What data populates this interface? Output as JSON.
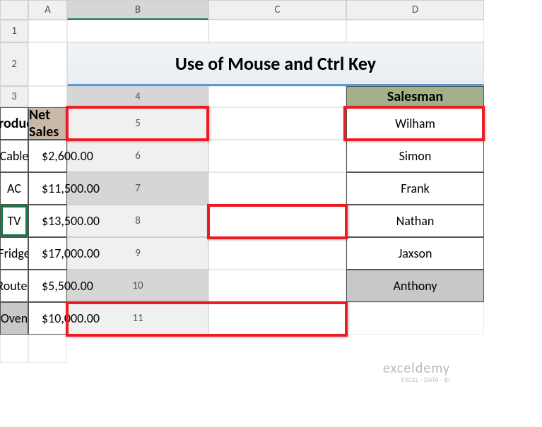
{
  "cols": [
    "A",
    "B",
    "C",
    "D"
  ],
  "rows": [
    "1",
    "2",
    "3",
    "4",
    "5",
    "6",
    "7",
    "8",
    "9",
    "10",
    "11"
  ],
  "title": "Use of Mouse and Ctrl Key",
  "headers": {
    "b": "Salesman",
    "c": "Product",
    "d": "Net Sales"
  },
  "table": [
    {
      "salesman": "Wilham",
      "product": "Cable",
      "sym": "$",
      "sales": "2,600.00"
    },
    {
      "salesman": "Simon",
      "product": "AC",
      "sym": "$",
      "sales": "11,500.00"
    },
    {
      "salesman": "Frank",
      "product": "TV",
      "sym": "$",
      "sales": "13,500.00"
    },
    {
      "salesman": "Nathan",
      "product": "Fridge",
      "sym": "$",
      "sales": "17,000.00"
    },
    {
      "salesman": "Jaxson",
      "product": "Router",
      "sym": "$",
      "sales": "5,500.00"
    },
    {
      "salesman": "Anthony",
      "product": "Oven",
      "sym": "$",
      "sales": "10,000.00"
    }
  ],
  "watermark": {
    "brand": "exceldemy",
    "tag": "EXCEL · DATA · BI"
  }
}
